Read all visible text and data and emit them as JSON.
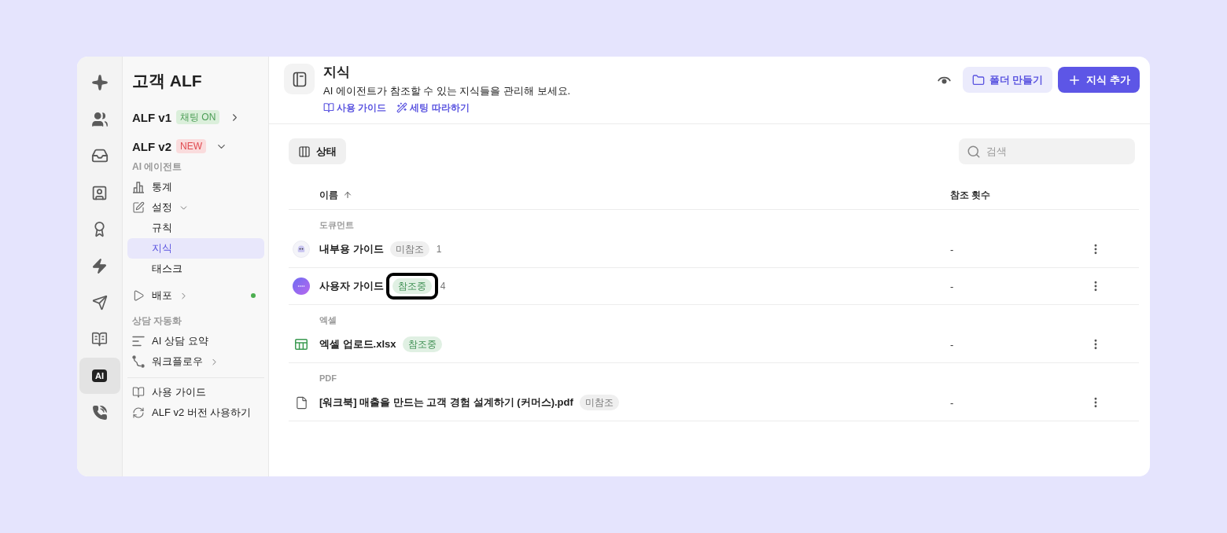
{
  "rail": {
    "items": [
      {
        "kind": "sparkle",
        "selected": false
      },
      {
        "kind": "people",
        "selected": false
      },
      {
        "kind": "inbox",
        "selected": false
      },
      {
        "kind": "contact",
        "selected": false
      },
      {
        "kind": "award",
        "selected": false
      },
      {
        "kind": "bolt",
        "selected": false
      },
      {
        "kind": "send",
        "selected": false
      },
      {
        "kind": "book",
        "selected": false
      },
      {
        "kind": "ai",
        "label": "AI",
        "selected": true
      },
      {
        "kind": "phone",
        "selected": false
      }
    ]
  },
  "sidebar": {
    "title": "고객 ALF",
    "versions": [
      {
        "name": "ALF v1",
        "badge": {
          "text": "채팅 ON",
          "kind": "on"
        },
        "expanded": false
      },
      {
        "name": "ALF v2",
        "badge": {
          "text": "NEW",
          "kind": "new"
        },
        "expanded": true
      }
    ],
    "sections": [
      {
        "heading": "AI 에이전트",
        "items": [
          {
            "kind": "stats",
            "label": "통계",
            "selected": false
          },
          {
            "kind": "settings",
            "label": "설정",
            "selected": false,
            "expanded": true,
            "children": [
              {
                "label": "규칙",
                "selected": false
              },
              {
                "label": "지식",
                "selected": true
              },
              {
                "label": "태스크",
                "selected": false
              }
            ]
          },
          {
            "kind": "deploy",
            "label": "배포",
            "selected": false,
            "expanded": false,
            "live": true
          }
        ]
      },
      {
        "heading": "상담 자동화",
        "items": [
          {
            "kind": "summary",
            "label": "AI 상담 요약",
            "selected": false
          },
          {
            "kind": "workflow",
            "label": "워크플로우",
            "selected": false,
            "expanded": false
          }
        ]
      }
    ],
    "footer_links": [
      {
        "kind": "guide",
        "label": "사용 가이드"
      },
      {
        "kind": "switch",
        "label": "ALF v2 버전 사용하기"
      }
    ]
  },
  "header": {
    "title": "지식",
    "description": "AI 에이전트가 참조할 수 있는 지식들을 관리해 보세요.",
    "links": [
      {
        "kind": "guide",
        "label": "사용 가이드"
      },
      {
        "kind": "setup",
        "label": "세팅 따라하기"
      }
    ],
    "actions": [
      {
        "kind": "secondary",
        "label": "폴더 만들기"
      },
      {
        "kind": "primary",
        "label": "지식 추가"
      }
    ]
  },
  "toolbar": {
    "filter": {
      "label": "상태"
    },
    "search": {
      "placeholder": "검색"
    }
  },
  "table": {
    "columns": [
      {
        "label": "이름",
        "sorted_ascending": true
      },
      {
        "label": "참조 횟수"
      }
    ],
    "groups": [
      {
        "label": "도큐먼트",
        "rows": [
          {
            "kind": "bot",
            "name": "내부용 가이드",
            "status": {
              "text": "미참조",
              "kind": "idle"
            },
            "count": "1",
            "references": "-",
            "highlighted": false
          },
          {
            "kind": "chat",
            "name": "사용자 가이드",
            "status": {
              "text": "참조중",
              "kind": "active"
            },
            "count": "4",
            "references": "-",
            "highlighted": true
          }
        ]
      },
      {
        "label": "엑셀",
        "rows": [
          {
            "kind": "sheet",
            "name": "엑셀 업로드.xlsx",
            "status": {
              "text": "참조중",
              "kind": "active"
            },
            "references": "-",
            "highlighted": false
          }
        ]
      },
      {
        "label": "PDF",
        "rows": [
          {
            "kind": "file",
            "name": "[워크북] 매출을 만드는 고객 경험 설계하기 (커머스).pdf",
            "status": {
              "text": "미참조",
              "kind": "idle"
            },
            "references": "-",
            "highlighted": false
          }
        ]
      }
    ]
  }
}
